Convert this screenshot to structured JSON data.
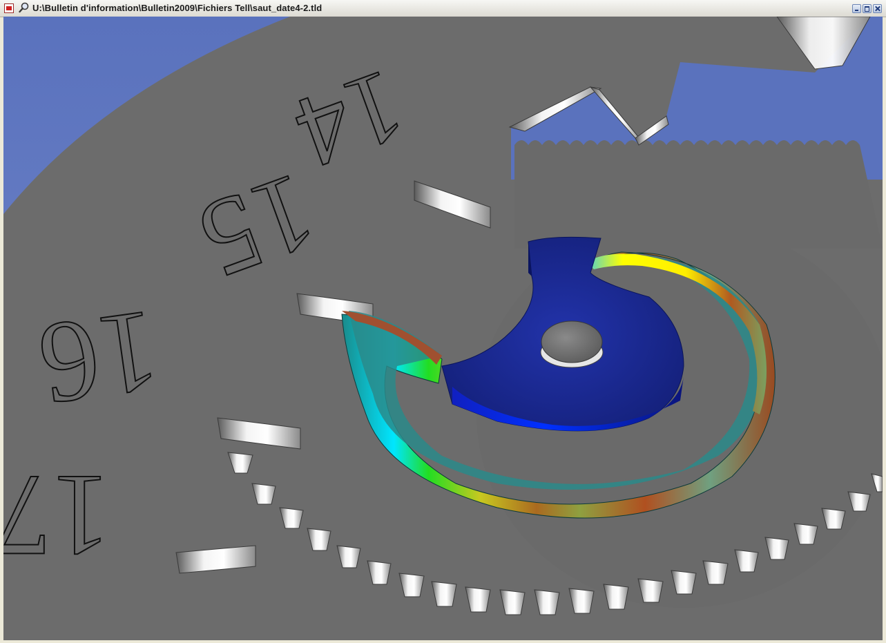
{
  "window": {
    "title": "U:\\Bulletin d'information\\Bulletin2009\\Fichiers Tell\\saut_date4-2.tld",
    "buttons": [
      "minimize",
      "maximize",
      "close"
    ]
  },
  "viewport": {
    "dial_numbers": [
      "14",
      "15",
      "16",
      "17"
    ],
    "colors": {
      "background_top": "#5a72bd",
      "background_bottom": "#ffffff",
      "metal_gray": "#6c6c6c",
      "stress_low": "#1a2a9a",
      "stress_mid": "#1e7070",
      "stress_high": "#ffee00"
    }
  }
}
